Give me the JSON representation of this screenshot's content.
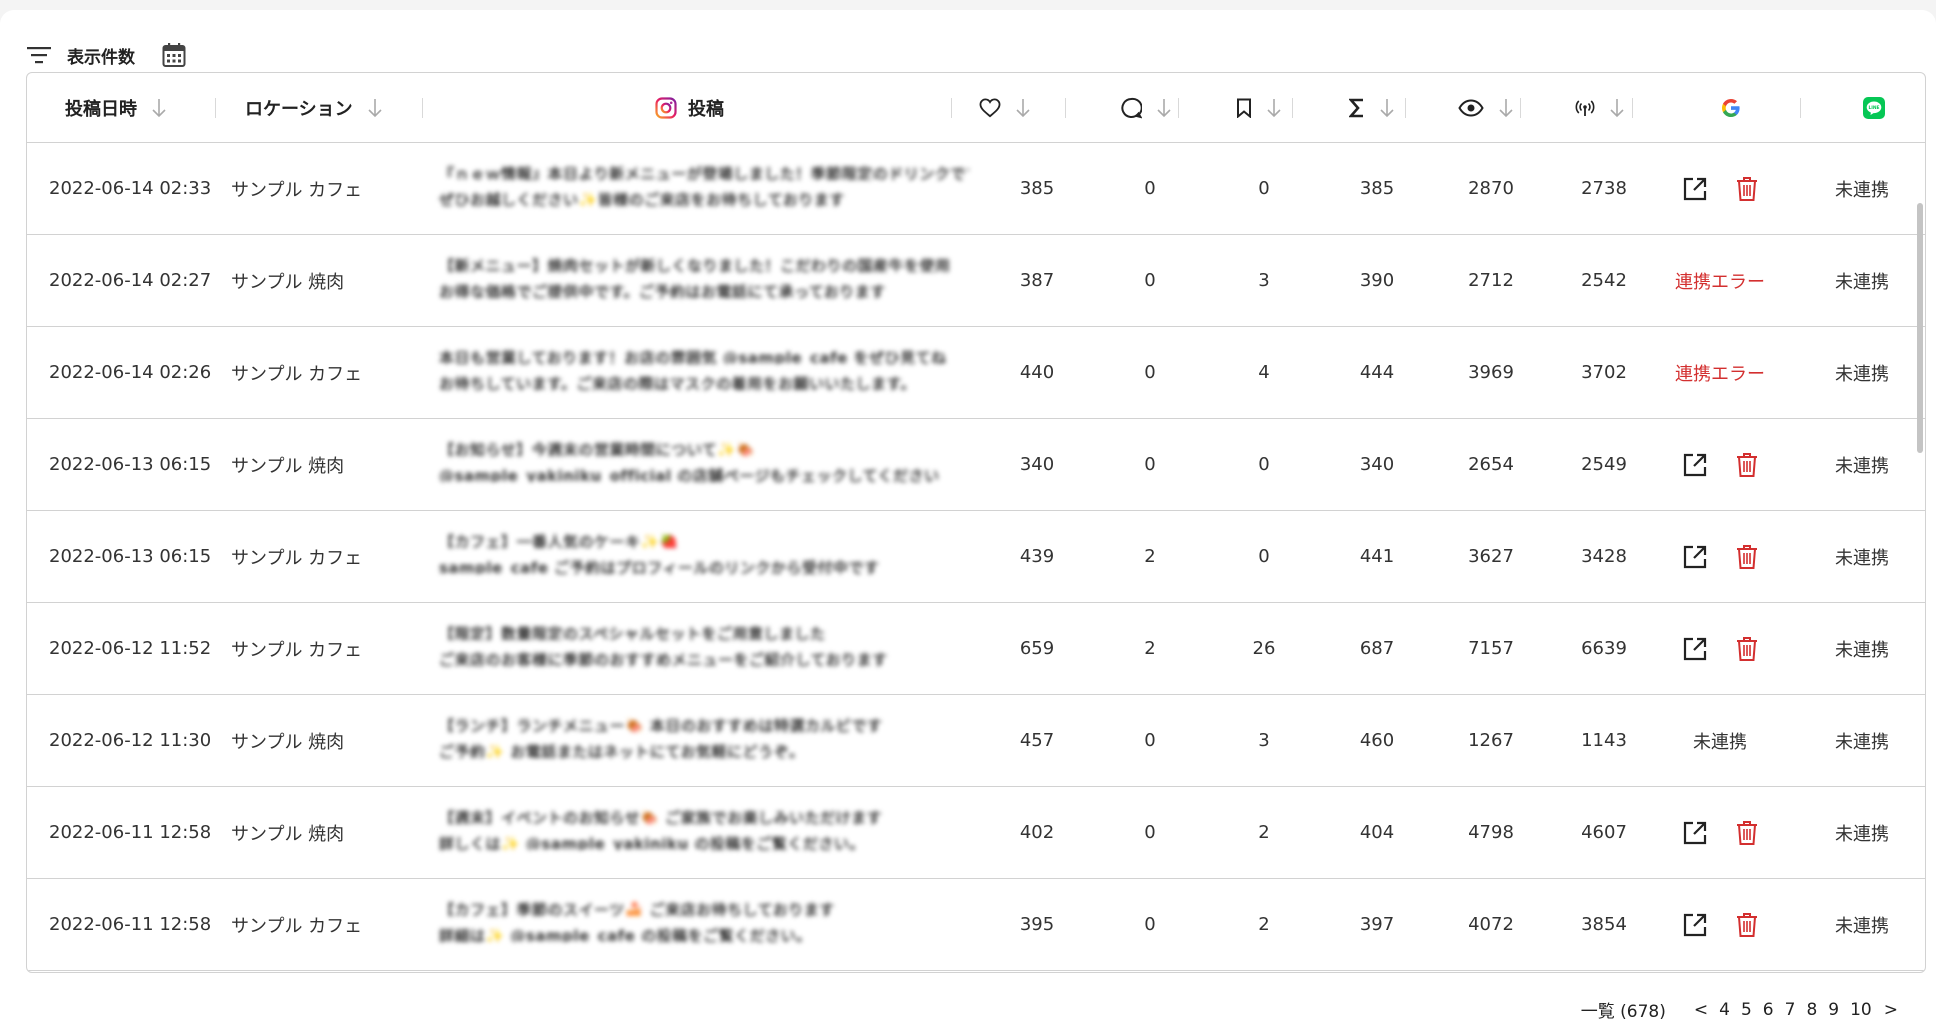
{
  "toolbar": {
    "display_count_label": "表示件数"
  },
  "columns": {
    "date": "投稿日時",
    "location": "ロケーション",
    "post": "投稿"
  },
  "icons": {
    "filter": "filter-icon",
    "calendar": "calendar-icon",
    "instagram": "instagram-icon",
    "like": "heart-icon",
    "comment": "comment-icon",
    "save": "bookmark-icon",
    "total": "sigma-icon",
    "impressions": "eye-icon",
    "reach": "broadcast-icon",
    "google": "google-icon",
    "line": "line-icon",
    "open": "external-link-icon",
    "delete": "trash-icon"
  },
  "colors": {
    "error": "#d32f2f",
    "delete": "#d32f2f",
    "line": "#06c755"
  },
  "rows": [
    {
      "date": "2022-06-14 02:33",
      "location": "サンプル カフェ",
      "post1": "『ｎｅｗ情報』本日より新メニューが登場しました！季節限定のドリンクです",
      "post2": "ぜひお越しください✨皆様のご来店をお待ちしております",
      "likes": "385",
      "comments": "0",
      "saves": "0",
      "total": "385",
      "impressions": "2870",
      "reach": "2738",
      "google": "actions",
      "line": "未連携"
    },
    {
      "date": "2022-06-14 02:27",
      "location": "サンプル 焼肉",
      "post1": "【新メニュー】焼肉セットが新しくなりました！こだわりの国産牛を使用",
      "post2": "お得な価格でご提供中です。ご予約はお電話にて承っております",
      "likes": "387",
      "comments": "0",
      "saves": "3",
      "total": "390",
      "impressions": "2712",
      "reach": "2542",
      "google": "連携エラー",
      "line": "未連携"
    },
    {
      "date": "2022-06-14 02:26",
      "location": "サンプル カフェ",
      "post1": "本日も営業しております！お店の雰囲気 @sample_cafe をぜひ見てね",
      "post2": "お待ちしています。ご来店の際はマスクの着用をお願いいたします。",
      "likes": "440",
      "comments": "0",
      "saves": "4",
      "total": "444",
      "impressions": "3969",
      "reach": "3702",
      "google": "連携エラー",
      "line": "未連携"
    },
    {
      "date": "2022-06-13 06:15",
      "location": "サンプル 焼肉",
      "post1": "【お知らせ】今週末の営業時間について✨🍖",
      "post2": "@sample_yakiniku_official の店舗ページもチェックしてください",
      "likes": "340",
      "comments": "0",
      "saves": "0",
      "total": "340",
      "impressions": "2654",
      "reach": "2549",
      "google": "actions",
      "line": "未連携"
    },
    {
      "date": "2022-06-13 06:15",
      "location": "サンプル カフェ",
      "post1": "【カフェ】一番人気のケーキ✨🍓",
      "post2": "sample_cafe ご予約はプロフィールのリンクから受付中です",
      "likes": "439",
      "comments": "2",
      "saves": "0",
      "total": "441",
      "impressions": "3627",
      "reach": "3428",
      "google": "actions",
      "line": "未連携"
    },
    {
      "date": "2022-06-12 11:52",
      "location": "サンプル カフェ",
      "post1": "【限定】数量限定のスペシャルセットをご用意しました",
      "post2": "ご来店のお客様に季節のおすすめメニューをご紹介しております",
      "likes": "659",
      "comments": "2",
      "saves": "26",
      "total": "687",
      "impressions": "7157",
      "reach": "6639",
      "google": "actions",
      "line": "未連携"
    },
    {
      "date": "2022-06-12 11:30",
      "location": "サンプル 焼肉",
      "post1": "【ランチ】ランチメニュー🍖 本日のおすすめは特選カルビです",
      "post2": "ご予約✨ お電話またはネットにてお気軽にどうぞ。",
      "likes": "457",
      "comments": "0",
      "saves": "3",
      "total": "460",
      "impressions": "1267",
      "reach": "1143",
      "google": "未連携",
      "line": "未連携"
    },
    {
      "date": "2022-06-11 12:58",
      "location": "サンプル 焼肉",
      "post1": "【週末】イベントのお知らせ🍖 ご家族でお楽しみいただけます",
      "post2": "詳しくは✨ @sample_yakiniku の投稿をご覧ください。",
      "likes": "402",
      "comments": "0",
      "saves": "2",
      "total": "404",
      "impressions": "4798",
      "reach": "4607",
      "google": "actions",
      "line": "未連携"
    },
    {
      "date": "2022-06-11 12:58",
      "location": "サンプル カフェ",
      "post1": "【カフェ】季節のスイーツ🍰 ご来店お待ちしております",
      "post2": "詳細は✨ @sample_cafe の投稿をご覧ください。",
      "likes": "395",
      "comments": "0",
      "saves": "2",
      "total": "397",
      "impressions": "4072",
      "reach": "3854",
      "google": "actions",
      "line": "未連携"
    }
  ],
  "pagination": {
    "total_label": "一覧 (678)",
    "prev": "<",
    "next": ">",
    "pages": [
      "4",
      "5",
      "6",
      "7",
      "8",
      "9",
      "10"
    ]
  }
}
